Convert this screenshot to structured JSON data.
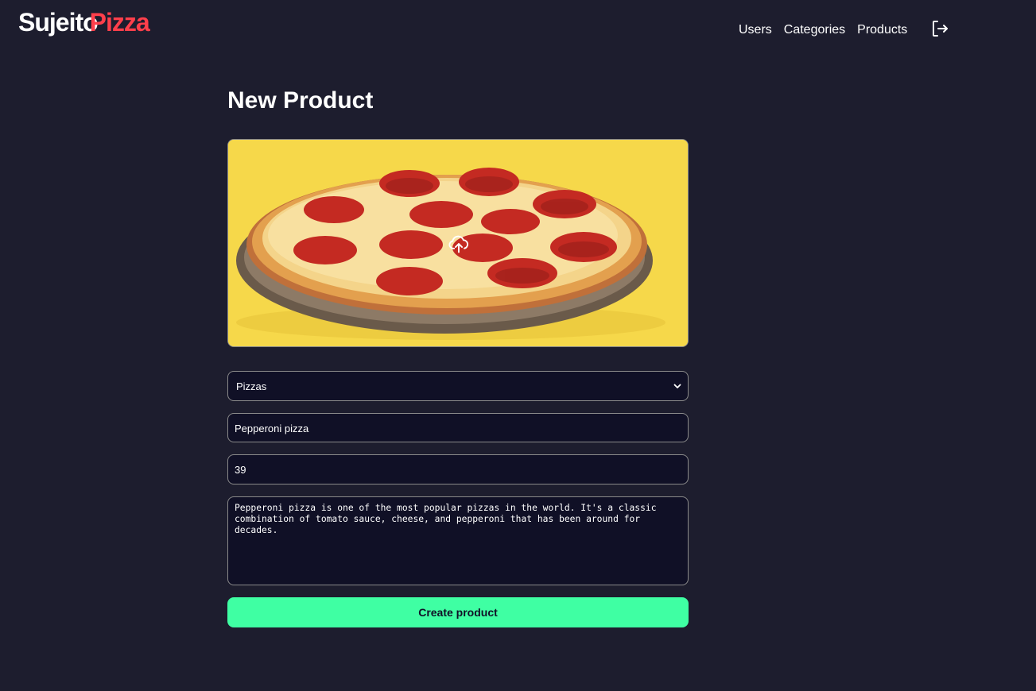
{
  "header": {
    "logo_primary": "Sujeito",
    "logo_accent": "Pizza",
    "nav": [
      "Users",
      "Categories",
      "Products"
    ],
    "logout_icon": "logout-icon"
  },
  "form": {
    "title": "New Product",
    "image": {
      "alt": "Pepperoni pizza photo",
      "upload_icon": "cloud-upload-icon"
    },
    "category": {
      "selected": "Pizzas"
    },
    "name": {
      "value": "Pepperoni pizza"
    },
    "price": {
      "value": "39"
    },
    "description": {
      "value": "Pepperoni pizza is one of the most popular pizzas in the world. It's a classic combination of tomato sauce, cheese, and pepperoni that has been around for decades."
    },
    "submit_label": "Create product"
  },
  "colors": {
    "background": "#1d1d2e",
    "input_bg": "#101026",
    "accent_red": "#ff3f4b",
    "accent_green": "#3fffa3"
  }
}
